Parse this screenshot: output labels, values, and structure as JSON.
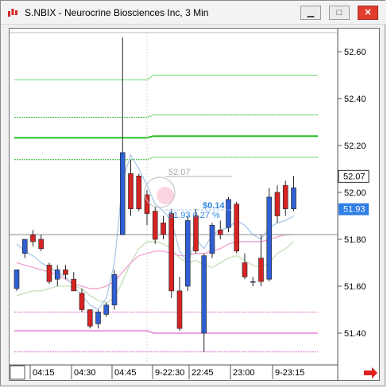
{
  "window": {
    "title": "S.NBIX - Neurocrine Biosciences Inc, 3 Min",
    "minimize_glyph": "▁",
    "maximize_glyph": "□",
    "close_glyph": "✕"
  },
  "colors": {
    "up": "#2f5fd0",
    "down": "#d62424",
    "green_line": "#27c227",
    "pink_line": "#e040c0",
    "ma_blue": "#a9c8ea",
    "ma_pink": "#f0a0d0",
    "ma_green": "#c4dfb8",
    "last_price_box": "#2f7fe6"
  },
  "axis": {
    "price_ticks": [
      "52.60",
      "52.40",
      "52.20",
      "52.00",
      "51.80",
      "51.60",
      "51.40"
    ],
    "time_ticks": [
      "04:15",
      "04:30",
      "04:45",
      "9-22:30",
      "22:45",
      "23:00",
      "9-23:15"
    ],
    "current_price": "52.07",
    "last_price": "51.93"
  },
  "annotations": {
    "ref_price": "52.07",
    "delta": "$0.14",
    "measure": "51.93 0.27 %"
  },
  "icons": {
    "scroll_right": "arrow-right-icon",
    "corner": "chart-corner-box"
  },
  "chart_data": {
    "type": "candlestick",
    "title": "S.NBIX - Neurocrine Biosciences Inc, 3 Min",
    "ylim": [
      51.3,
      52.72
    ],
    "candles": [
      {
        "o": 51.59,
        "h": 51.67,
        "c": 51.67,
        "l": 51.58
      },
      {
        "o": 51.74,
        "h": 51.8,
        "c": 51.8,
        "l": 51.72
      },
      {
        "o": 51.82,
        "h": 51.84,
        "c": 51.79,
        "l": 51.77
      },
      {
        "o": 51.8,
        "h": 51.82,
        "c": 51.76,
        "l": 51.75
      },
      {
        "o": 51.69,
        "h": 51.7,
        "c": 51.62,
        "l": 51.61
      },
      {
        "o": 51.63,
        "h": 51.69,
        "c": 51.67,
        "l": 51.6
      },
      {
        "o": 51.67,
        "h": 51.69,
        "c": 51.65,
        "l": 51.63
      },
      {
        "o": 51.63,
        "h": 51.66,
        "c": 51.58,
        "l": 51.58
      },
      {
        "o": 51.57,
        "h": 51.59,
        "c": 51.5,
        "l": 51.49
      },
      {
        "o": 51.5,
        "h": 51.5,
        "c": 51.43,
        "l": 51.42
      },
      {
        "o": 51.44,
        "h": 51.5,
        "c": 51.49,
        "l": 51.42
      },
      {
        "o": 51.48,
        "h": 51.53,
        "c": 51.52,
        "l": 51.47
      },
      {
        "o": 51.52,
        "h": 51.67,
        "c": 51.65,
        "l": 51.5
      },
      {
        "o": 51.82,
        "h": 52.66,
        "c": 52.17,
        "l": 51.82
      },
      {
        "o": 52.08,
        "h": 52.14,
        "c": 51.93,
        "l": 51.9
      },
      {
        "o": 52.07,
        "h": 52.08,
        "c": 51.93,
        "l": 51.92
      },
      {
        "o": 51.99,
        "h": 52.01,
        "c": 51.91,
        "l": 51.86
      },
      {
        "o": 51.92,
        "h": 51.94,
        "c": 51.8,
        "l": 51.78
      },
      {
        "o": 51.87,
        "h": 51.9,
        "c": 51.82,
        "l": 51.8
      },
      {
        "o": 51.91,
        "h": 51.93,
        "c": 51.58,
        "l": 51.55
      },
      {
        "o": 51.58,
        "h": 51.64,
        "c": 51.42,
        "l": 51.41
      },
      {
        "o": 51.6,
        "h": 51.9,
        "c": 51.88,
        "l": 51.58
      },
      {
        "o": 51.9,
        "h": 51.93,
        "c": 51.75,
        "l": 51.74
      },
      {
        "o": 51.4,
        "h": 51.74,
        "c": 51.73,
        "l": 51.32
      },
      {
        "o": 51.74,
        "h": 51.87,
        "c": 51.86,
        "l": 51.72
      },
      {
        "o": 51.84,
        "h": 51.88,
        "c": 51.82,
        "l": 51.8
      },
      {
        "o": 51.85,
        "h": 51.98,
        "c": 51.97,
        "l": 51.83
      },
      {
        "o": 51.95,
        "h": 51.96,
        "c": 51.75,
        "l": 51.74
      },
      {
        "o": 51.7,
        "h": 51.74,
        "c": 51.64,
        "l": 51.63
      },
      {
        "o": 51.62,
        "h": 51.64,
        "c": 51.62,
        "l": 51.6
      },
      {
        "o": 51.72,
        "h": 51.82,
        "c": 51.62,
        "l": 51.6
      },
      {
        "o": 51.63,
        "h": 52.02,
        "c": 51.98,
        "l": 51.62
      },
      {
        "o": 52.0,
        "h": 52.03,
        "c": 51.9,
        "l": 51.87
      },
      {
        "o": 52.03,
        "h": 52.05,
        "c": 51.93,
        "l": 51.9
      },
      {
        "o": 51.93,
        "h": 52.07,
        "c": 52.02,
        "l": 51.92
      }
    ],
    "levels": {
      "green_solid": [
        52.24
      ],
      "green_light": [
        52.5
      ],
      "green_dashed": [
        52.33,
        52.15
      ],
      "pink_solid": [
        51.4
      ],
      "pink_dashed": [
        51.49,
        51.32
      ]
    },
    "ma_blue": [
      51.78,
      51.75,
      51.73,
      51.7,
      51.68,
      51.66,
      51.64,
      51.6,
      51.56,
      51.52,
      51.5,
      51.55,
      51.7,
      52.05,
      52.16,
      52.1,
      52.03,
      51.95,
      51.92,
      51.88,
      51.75,
      51.7,
      51.8,
      51.76,
      51.82,
      51.84,
      51.85,
      51.88,
      51.86,
      51.82,
      51.8,
      51.85,
      51.87,
      51.88,
      51.9
    ],
    "ma_pink": [
      51.7,
      51.69,
      51.68,
      51.67,
      51.66,
      51.65,
      51.63,
      51.61,
      51.6,
      51.59,
      51.59,
      51.6,
      51.62,
      51.66,
      51.7,
      51.73,
      51.74,
      51.75,
      51.75,
      51.74,
      51.73,
      51.73,
      51.74,
      51.74,
      51.75,
      51.76,
      51.78,
      51.79,
      51.79,
      51.79,
      51.79,
      51.8,
      51.81,
      51.82,
      51.82
    ],
    "ma_green": [
      51.56,
      51.57,
      51.58,
      51.58,
      51.59,
      51.6,
      51.6,
      51.6,
      51.59,
      51.56,
      51.54,
      51.53,
      51.55,
      51.62,
      51.7,
      51.76,
      51.79,
      51.79,
      51.78,
      51.76,
      51.72,
      51.7,
      51.71,
      51.69,
      51.68,
      51.7,
      51.72,
      51.73,
      51.71,
      51.69,
      51.68,
      51.7,
      51.74,
      51.76,
      51.79
    ]
  }
}
